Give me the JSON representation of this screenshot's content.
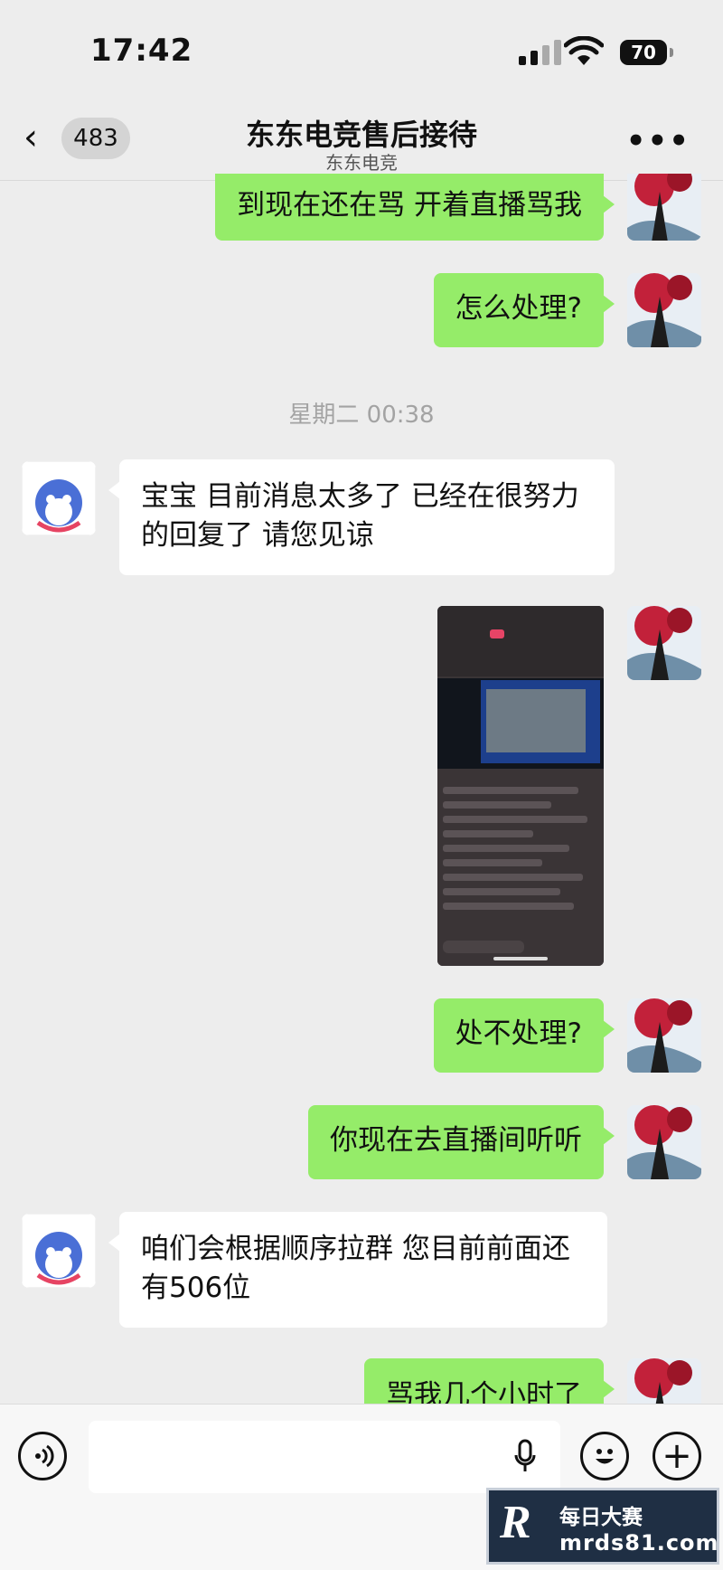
{
  "status": {
    "time": "17:42",
    "battery": "70"
  },
  "nav": {
    "back_count": "483",
    "title": "东东电竞售后接待",
    "subtitle": "东东电竞"
  },
  "messages": [
    {
      "text": "到现在还在骂 开着直播骂我"
    },
    {
      "text": "怎么处理?"
    },
    {
      "timestamp": "星期二 00:38"
    },
    {
      "text": "宝宝 目前消息太多了 已经在很努力的回复了 请您见谅"
    },
    {
      "image": "livestream-screenshot"
    },
    {
      "text": "处不处理?"
    },
    {
      "text": "你现在去直播间听听"
    },
    {
      "text": "咱们会根据顺序拉群 您目前前面还有506位"
    },
    {
      "text": "骂我几个小时了"
    }
  ],
  "watermark": {
    "logo": "R",
    "line1": "每日大赛",
    "line2": "mrds81.com"
  },
  "colors": {
    "out_bubble": "#95ec69",
    "in_bubble": "#ffffff",
    "background": "#ededed"
  }
}
